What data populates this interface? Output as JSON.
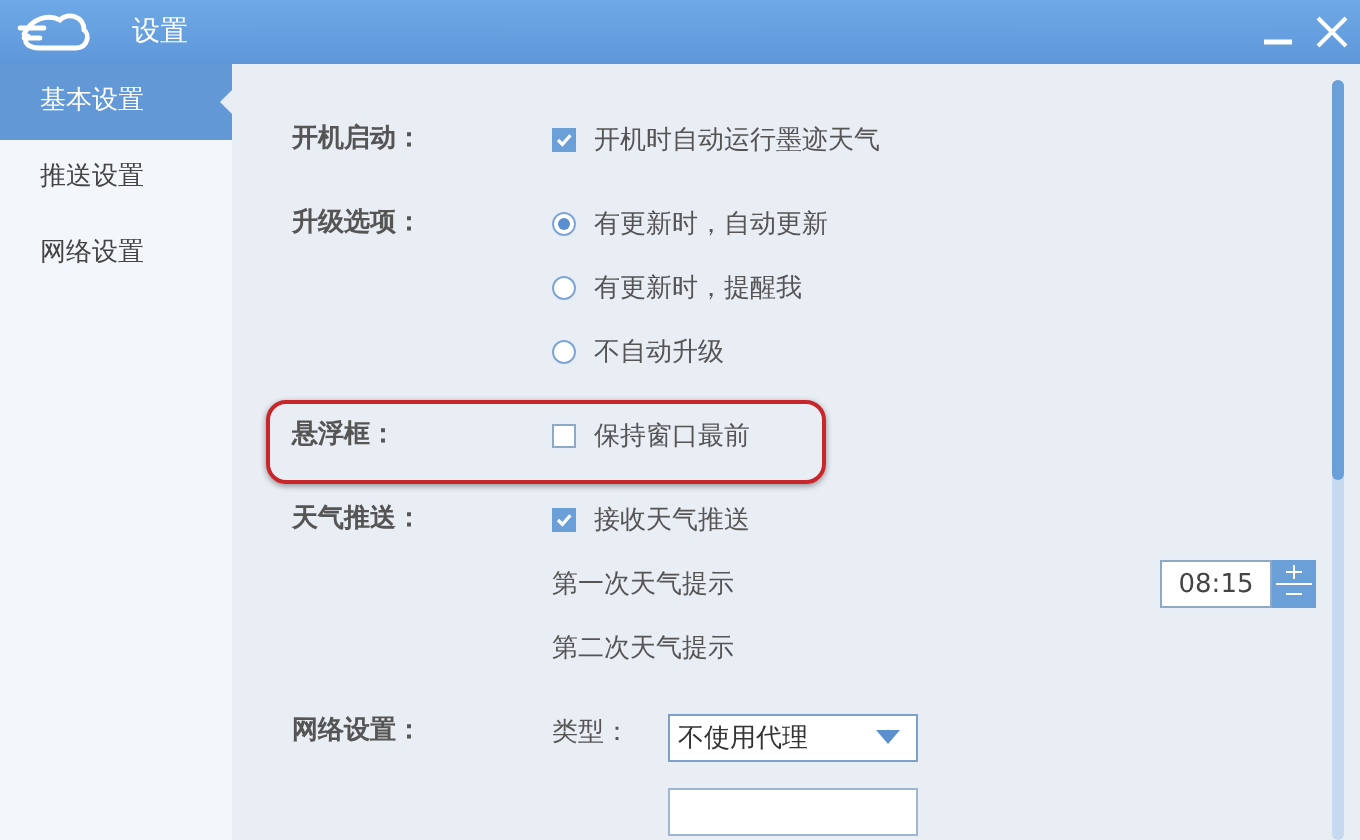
{
  "window": {
    "title": "设置"
  },
  "sidebar": {
    "items": [
      {
        "label": "基本设置",
        "selected": true
      },
      {
        "label": "推送设置",
        "selected": false
      },
      {
        "label": "网络设置",
        "selected": false
      }
    ]
  },
  "sections": [
    {
      "label": "开机启动：",
      "highlighted": false,
      "items": [
        {
          "kind": "checkbox",
          "text": "开机时自动运行墨迹天气",
          "checked": true
        }
      ]
    },
    {
      "label": "升级选项：",
      "highlighted": false,
      "items": [
        {
          "kind": "radio",
          "text": "有更新时，自动更新",
          "selected": true
        },
        {
          "kind": "radio",
          "text": "有更新时，提醒我",
          "selected": false
        },
        {
          "kind": "radio",
          "text": "不自动升级",
          "selected": false
        }
      ]
    },
    {
      "label": "悬浮框：",
      "highlighted": true,
      "items": [
        {
          "kind": "checkbox",
          "text": "保持窗口最前",
          "checked": false
        }
      ]
    },
    {
      "label": "天气推送：",
      "highlighted": false,
      "items": [
        {
          "kind": "checkbox",
          "text": "接收天气推送",
          "checked": true
        },
        {
          "kind": "time",
          "text": "第一次天气提示",
          "value": "08:15"
        },
        {
          "kind": "text",
          "text": "第二次天气提示"
        }
      ]
    },
    {
      "label": "网络设置：",
      "highlighted": false,
      "items": [
        {
          "kind": "select",
          "text": "类型：",
          "value": "不使用代理"
        },
        {
          "kind": "field"
        }
      ]
    }
  ]
}
